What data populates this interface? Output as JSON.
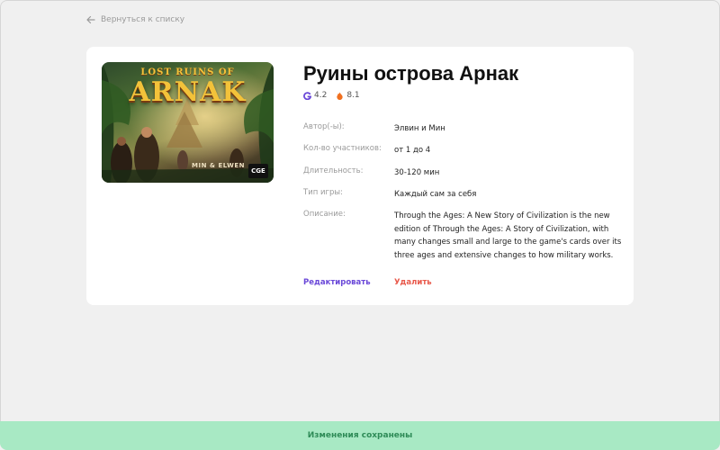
{
  "nav": {
    "back_label": "Вернуться к списку"
  },
  "game": {
    "title": "Руины острова Арнак",
    "cover": {
      "subtitle_text": "LOST RUINS OF",
      "title_text": "ARNAK",
      "authors_text": "MIN & ELWEN",
      "publisher_text": "CGE"
    },
    "ratings": [
      {
        "icon": "bgg-g-icon",
        "value": "4.2",
        "color": "#6a48d8"
      },
      {
        "icon": "tesera-flame-icon",
        "value": "8.1",
        "color": "#f07020"
      }
    ],
    "info": [
      {
        "label": "Автор(-ы):",
        "value": "Элвин и Мин"
      },
      {
        "label": "Кол-во участников:",
        "value": "от 1 до 4"
      },
      {
        "label": "Длительность:",
        "value": "30-120 мин"
      },
      {
        "label": "Тип игры:",
        "value": "Каждый сам за себя"
      },
      {
        "label": "Описание:",
        "value": "Through the Ages: A New Story of Civilization is the new edition of Through the Ages: A Story of Civilization, with many changes small and large to the game's cards over its three ages and extensive changes to how military works."
      }
    ]
  },
  "actions": {
    "edit_label": "Редактировать",
    "delete_label": "Удалить"
  },
  "toast": {
    "message": "Изменения сохранены"
  },
  "colors": {
    "accent": "#6a48d8",
    "danger": "#e8584a",
    "success_bg": "#a8e9c4",
    "success_text": "#2e8b57"
  }
}
